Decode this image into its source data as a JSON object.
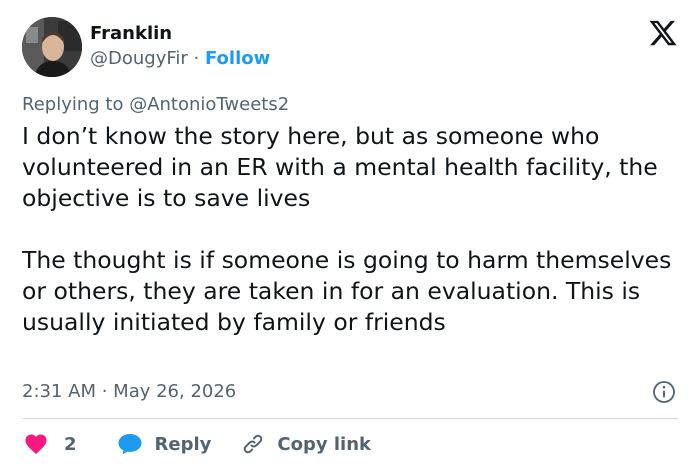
{
  "author": {
    "name": "Franklin",
    "handle": "@DougyFir",
    "separator": " · ",
    "follow_label": "Follow"
  },
  "reply_context": {
    "prefix": "Replying to ",
    "mention": "@AntonioTweets2"
  },
  "tweet": {
    "text": "I don’t know the story here, but as someone who volunteered in an ER with a mental health facility, the objective is to save lives\n\nThe thought is if someone is going to harm themselves or others, they are taken in for an evaluation. This is usually initiated by family or friends",
    "time": "2:31 AM",
    "date_separator": " · ",
    "date": "May 26, 2026"
  },
  "actions": {
    "like_count": "2",
    "reply_label": "Reply",
    "copy_link_label": "Copy link"
  },
  "icons": {
    "brand": "x-logo-icon",
    "info": "info-icon",
    "like": "heart-icon",
    "reply": "speech-bubble-icon",
    "copy": "link-icon"
  },
  "colors": {
    "like": "#f91880",
    "reply": "#1d9bf0",
    "link": "#1d9bf0",
    "secondary_text": "#536471",
    "primary_text": "#0f1419"
  }
}
